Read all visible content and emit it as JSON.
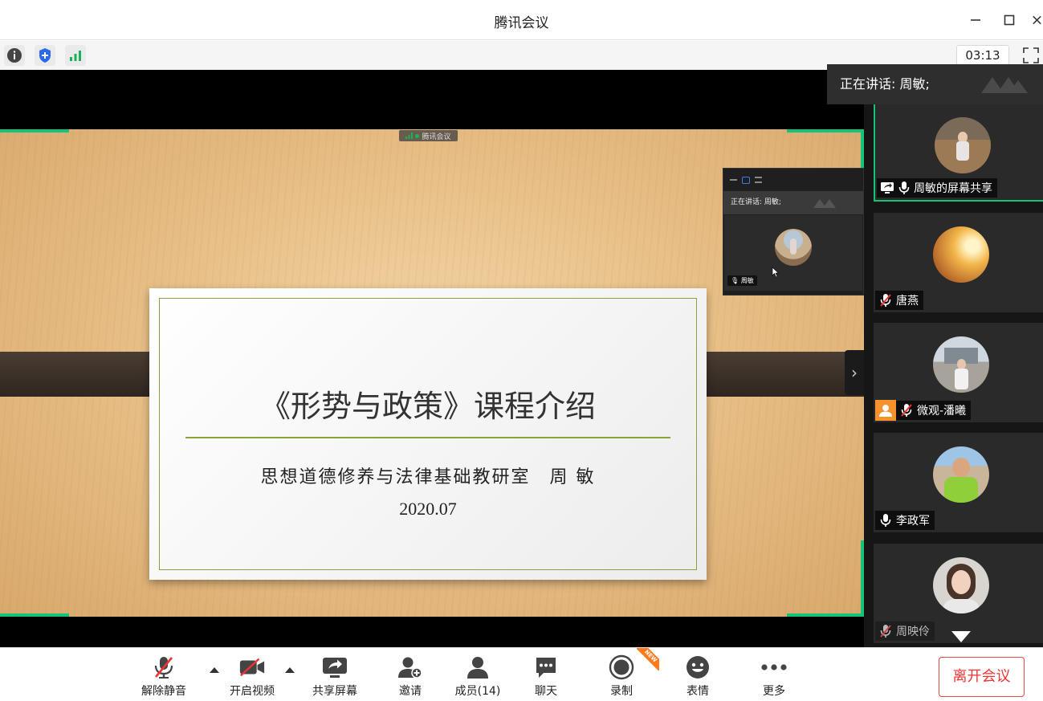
{
  "window": {
    "title": "腾讯会议"
  },
  "infobar": {
    "timer": "03:13"
  },
  "speaking": {
    "label": "正在讲话: 周敏;"
  },
  "share": {
    "tag": "腾讯会议",
    "slide": {
      "title": "《形势与政策》课程介绍",
      "subtitle": "思想道德修养与法律基础教研室　周 敏",
      "date": "2020.07"
    },
    "mini_window": {
      "speaking": "正在讲话: 周敏;",
      "name": "周敏"
    }
  },
  "participants": [
    {
      "name": "周敏的屏幕共享",
      "mic": "on",
      "sharing": true,
      "active": true
    },
    {
      "name": "唐燕",
      "mic": "muted"
    },
    {
      "name": "微观-潘曦",
      "mic": "muted",
      "default_avatar": true
    },
    {
      "name": "李政军",
      "mic": "on"
    },
    {
      "name": "周映伶",
      "mic": "muted"
    }
  ],
  "controls": {
    "unmute": "解除静音",
    "video": "开启视频",
    "share_screen": "共享屏幕",
    "invite": "邀请",
    "members": "成员(14)",
    "chat": "聊天",
    "record": "录制",
    "record_badge": "NEW",
    "emoji": "表情",
    "more": "更多",
    "leave": "离开会议"
  },
  "colors": {
    "accent_green": "#14c27a",
    "leave_red": "#e33333",
    "signal_green": "#1ab15a",
    "shield_blue": "#2a6ae8"
  }
}
